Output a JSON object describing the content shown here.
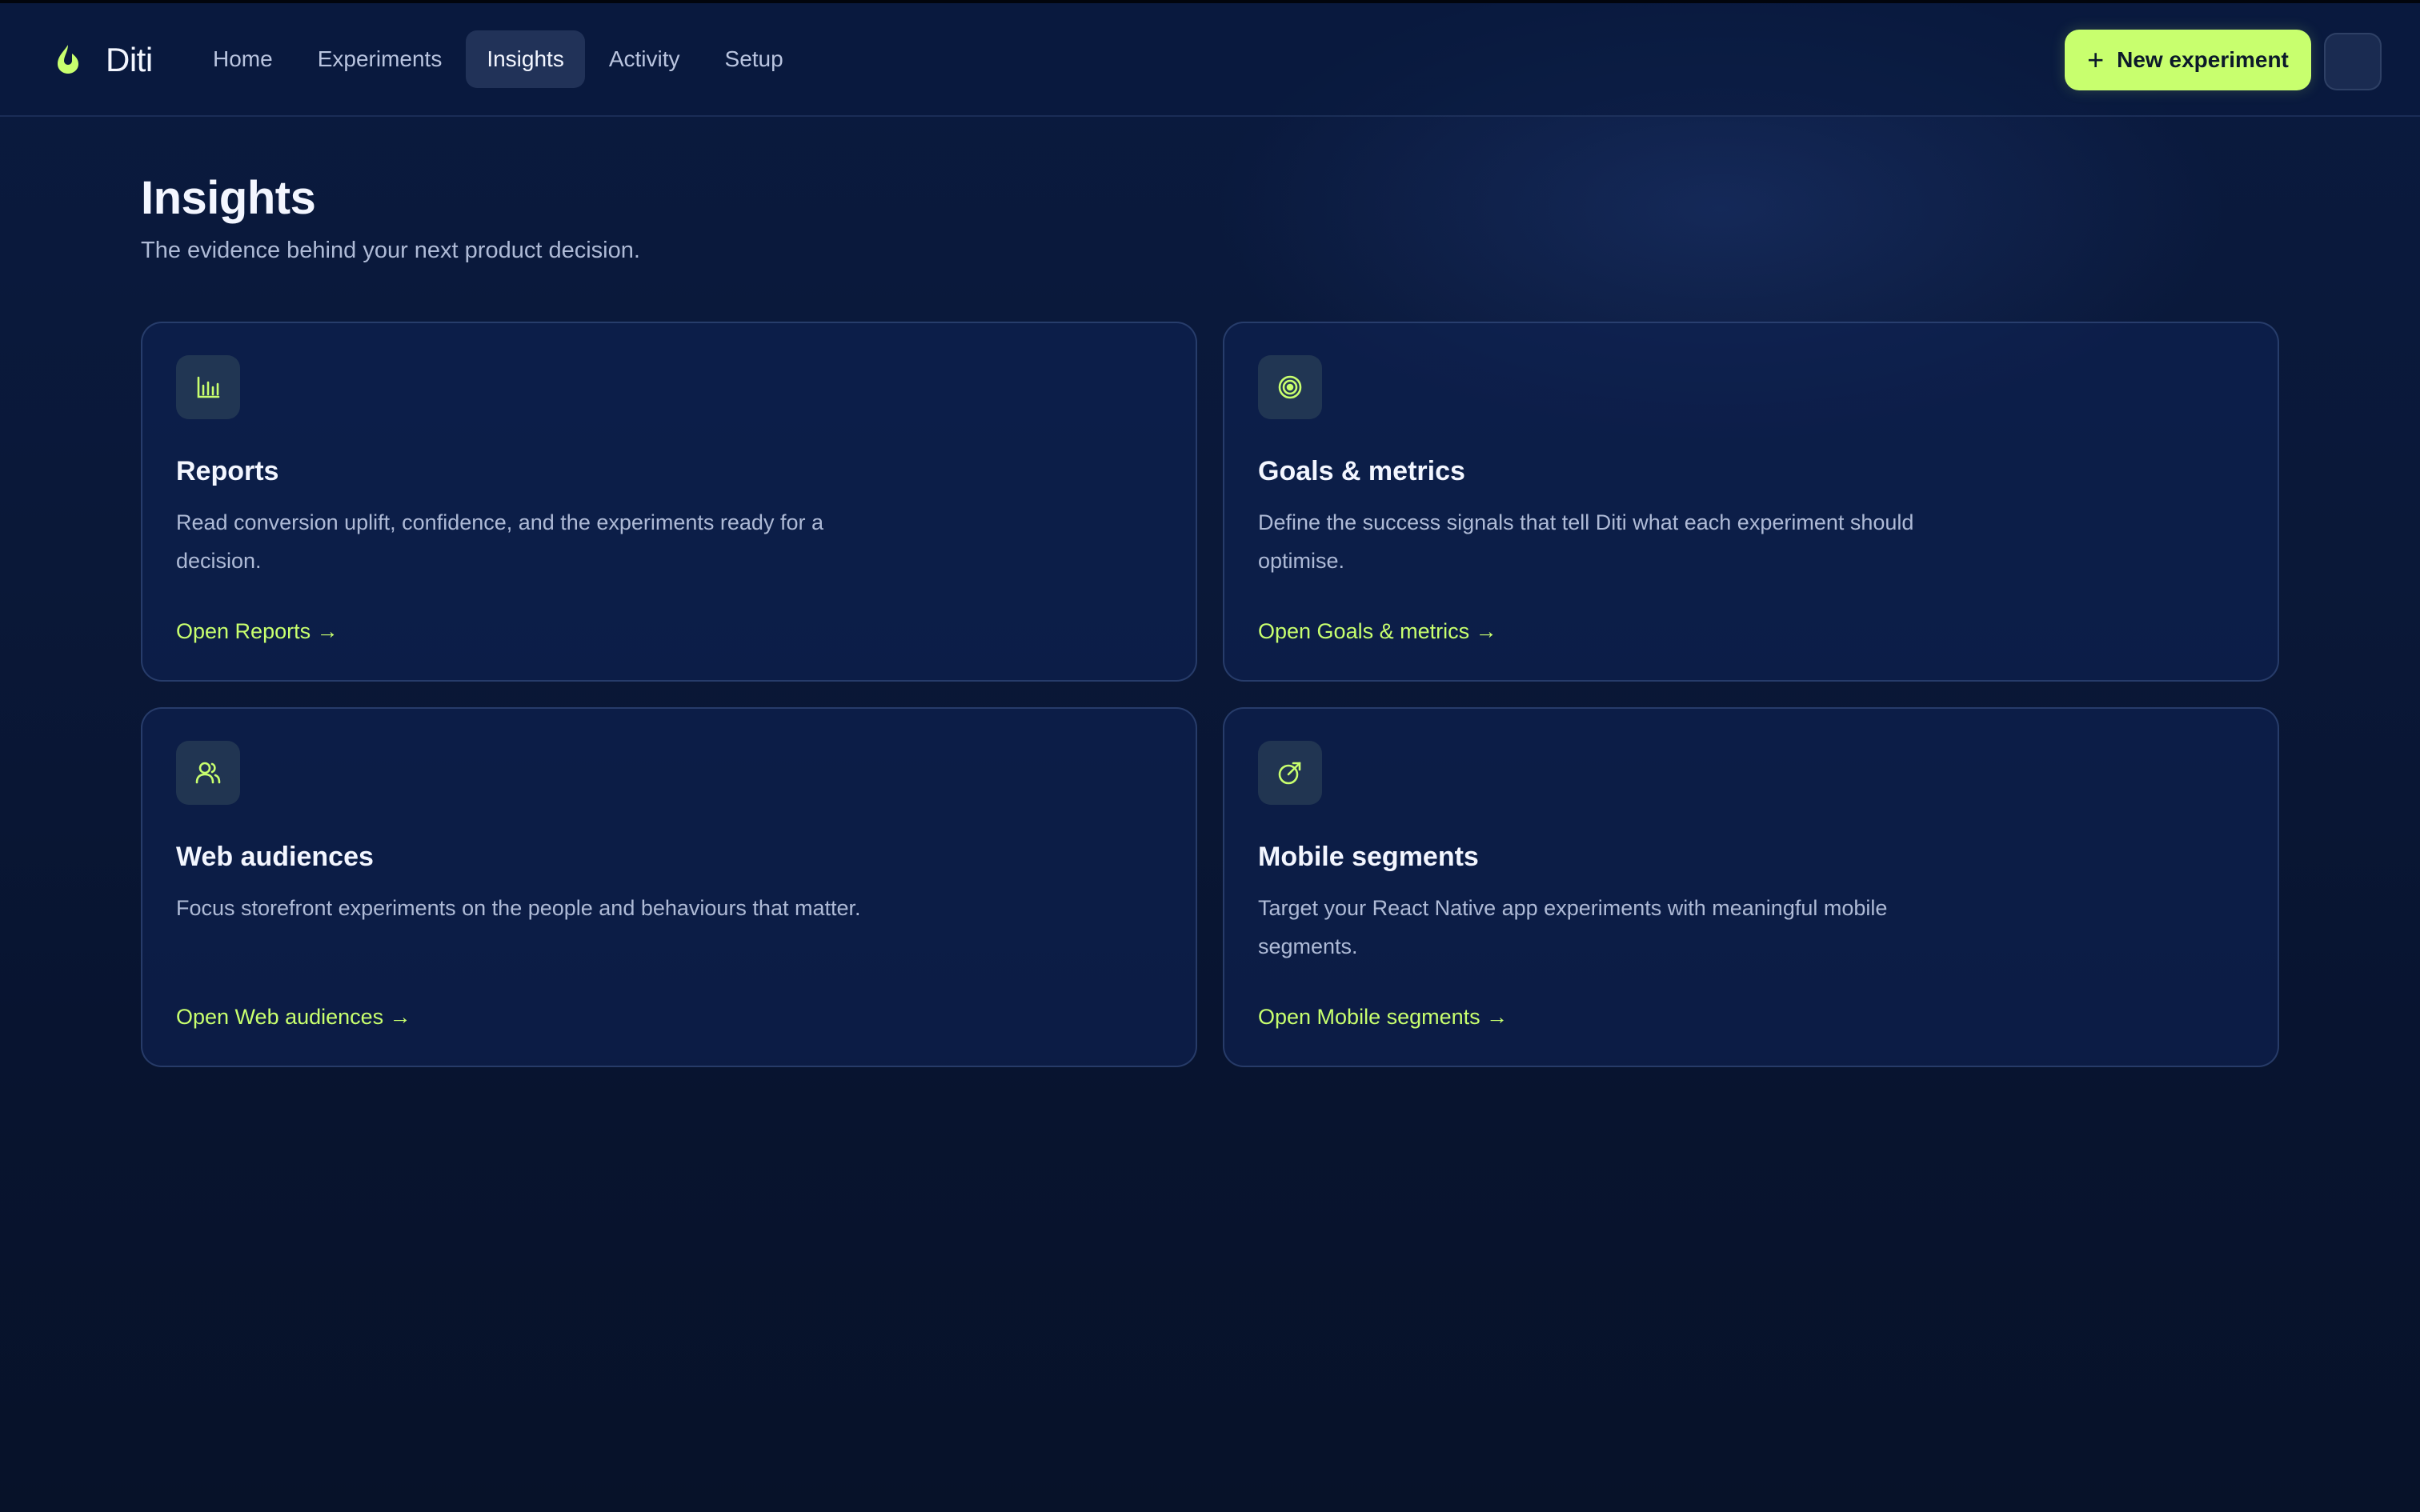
{
  "app": {
    "name": "Diti"
  },
  "nav": {
    "items": [
      {
        "label": "Home",
        "active": false
      },
      {
        "label": "Experiments",
        "active": false
      },
      {
        "label": "Insights",
        "active": true
      },
      {
        "label": "Activity",
        "active": false
      },
      {
        "label": "Setup",
        "active": false
      }
    ]
  },
  "header": {
    "new_experiment_label": "New experiment"
  },
  "page": {
    "title": "Insights",
    "subtitle": "The evidence behind your next product decision."
  },
  "cards": [
    {
      "icon": "bar-chart-icon",
      "title": "Reports",
      "description": "Read conversion uplift, confidence, and the experiments ready for a decision.",
      "link": "Open Reports →"
    },
    {
      "icon": "target-icon",
      "title": "Goals & metrics",
      "description": "Define the success signals that tell Diti what each experiment should optimise.",
      "link": "Open Goals & metrics →"
    },
    {
      "icon": "users-icon",
      "title": "Web audiences",
      "description": "Focus storefront experiments on the people and behaviours that matter.",
      "link": "Open Web audiences →"
    },
    {
      "icon": "mobile-target-icon",
      "title": "Mobile segments",
      "description": "Target your React Native app experiments with meaningful mobile segments.",
      "link": "Open Mobile segments →"
    }
  ],
  "colors": {
    "accent": "#c8ff6e",
    "background": "#081431",
    "card": "#0e2252"
  }
}
